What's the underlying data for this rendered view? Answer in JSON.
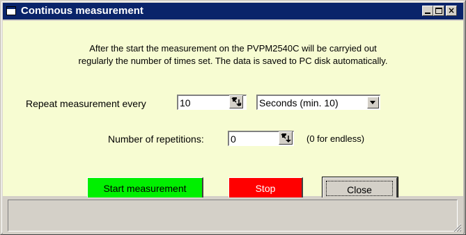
{
  "window": {
    "title": "Continous measurement",
    "controls": {
      "minimize": "_",
      "maximize": "□",
      "close": "×"
    }
  },
  "info": {
    "line1": "After the start the measurement on the PVPM2540C will be carryied out",
    "line2": "regularly the number of times set. The data is saved to PC disk automatically."
  },
  "repeat": {
    "label": "Repeat measurement every",
    "value": "10",
    "unit_selected": "Seconds (min. 10)"
  },
  "repetitions": {
    "label": "Number of repetitions:",
    "value": "0",
    "hint": "(0 for endless)"
  },
  "buttons": {
    "start": "Start measurement",
    "stop": "Stop",
    "close": "Close"
  },
  "status": {
    "text": ""
  },
  "colors": {
    "titlebar": "#0a246a",
    "client_bg": "#f7fcd2",
    "start_button": "#00f000",
    "stop_button": "#ff0000",
    "face": "#d4d0c8"
  }
}
